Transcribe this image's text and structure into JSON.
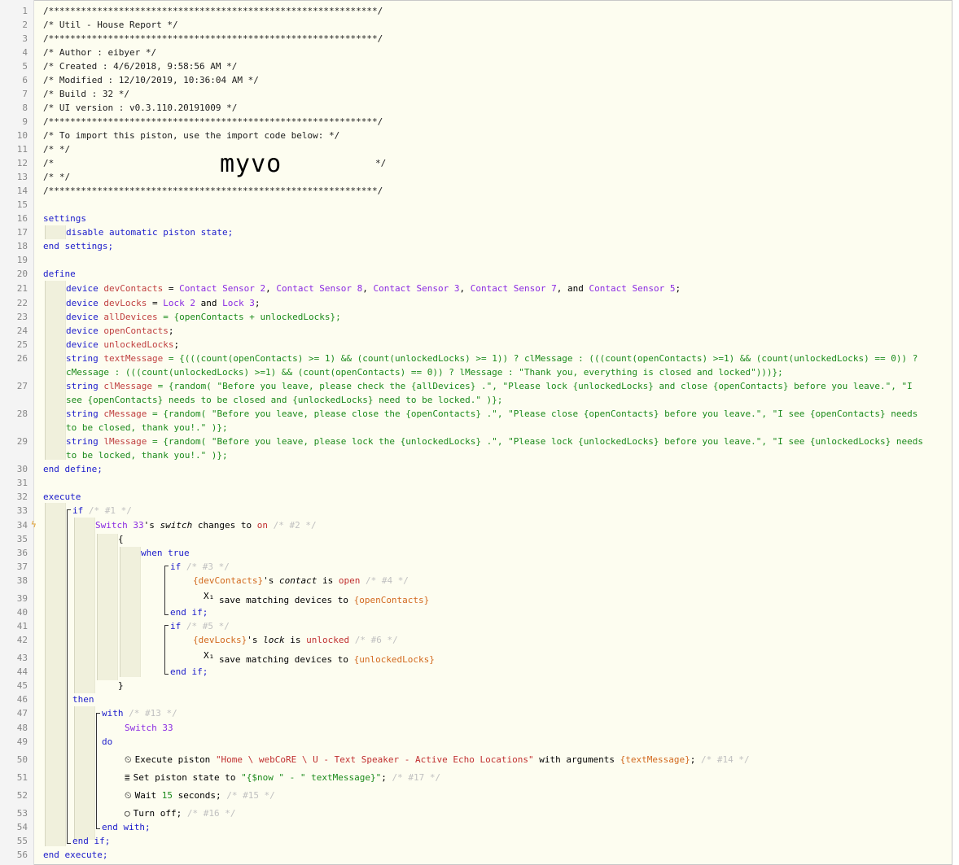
{
  "header": {
    "line1": "/*************************************************************/",
    "line2": "/* Util - House Report                                      */",
    "line3": "/*************************************************************/",
    "line4": "/* Author     : eibyer                                        */",
    "line5": "/* Created    : 4/6/2018, 9:58:56 AM                          */",
    "line6": "/* Modified   : 12/10/2019, 10:36:04 AM                       */",
    "line7": "/* Build      : 32                                            */",
    "line8": "/* UI version : v0.3.110.20191009                            */",
    "line9": "/*************************************************************/",
    "line10": "/* To import this piston, use the import code below:         */",
    "line11": "/*                                                           */",
    "line12a": "/*",
    "line12b": "*/",
    "line13": "/*                                                           */",
    "line14": "/*************************************************************/",
    "import_code": "myvo"
  },
  "settings": {
    "kw": "settings",
    "body": "disable automatic piston state;",
    "end": "end settings;"
  },
  "define": {
    "kw": "define",
    "end": "end define;",
    "device_kw": "device",
    "string_kw": "string",
    "devContacts": "devContacts",
    "contacts": [
      "Contact Sensor 2",
      "Contact Sensor 8",
      "Contact Sensor 3",
      "Contact Sensor 7",
      "Contact Sensor 5"
    ],
    "devLocks": "devLocks",
    "locks": [
      "Lock 2",
      "Lock 3"
    ],
    "allDevices": "allDevices",
    "allDevices_expr": "= {openContacts + unlockedLocks};",
    "openContacts": "openContacts",
    "unlockedLocks": "unlockedLocks",
    "textMessage": "textMessage",
    "textMessage_expr1": "= {(((count(openContacts) >= 1) && (count(unlockedLocks) >= 1)) ? clMessage : (((count(openContacts) >=1) && (count(unlockedLocks) == 0)) ?",
    "textMessage_expr2": "cMessage : (((count(unlockedLocks) >=1) && (count(openContacts) == 0)) ? lMessage : \"Thank you, everything is closed and locked\")))};",
    "clMessage": "clMessage",
    "clMessage_expr1": "= {random( \"Before you leave, please check the {allDevices} .\", \"Please lock {unlockedLocks} and close {openContacts} before you leave.\", \"I",
    "clMessage_expr2": "see {openContacts} needs to be closed and {unlockedLocks} need to be locked.\" )};",
    "cMessage": "cMessage",
    "cMessage_expr1": "= {random( \"Before you leave, please close the {openContacts} .\", \"Please close {openContacts} before you leave.\", \"I see {openContacts} needs",
    "cMessage_expr2": "to be closed, thank you!.\" )};",
    "lMessage": "lMessage",
    "lMessage_expr1": "= {random( \"Before you leave, please lock the {unlockedLocks} .\", \"Please lock {unlockedLocks} before you leave.\", \"I see {unlockedLocks} needs",
    "lMessage_expr2": "to be locked, thank you!.\" )};"
  },
  "execute": {
    "kw": "execute",
    "end": "end execute;",
    "if_kw": "if",
    "c1": "/* #1 */",
    "switch33": "Switch 33",
    "trigger_a": "'s ",
    "trigger_attr": "switch",
    "trigger_b": " changes to ",
    "trigger_val": "on",
    "c2": "/* #2 */",
    "lbrace": "{",
    "rbrace": "}",
    "when_true": "when true",
    "c3": "/* #3 */",
    "devContactsRef": "{devContacts}",
    "contact_attr": "contact",
    "is_kw": " is ",
    "open_val": "open",
    "c4": "/* #4 */",
    "x1": "X₁",
    "save_text": "save matching devices to ",
    "openContactsRef": "{openContacts}",
    "endif": "end if;",
    "c5": "/* #5 */",
    "devLocksRef": "{devLocks}",
    "lock_attr": "lock",
    "unlocked_val": "unlocked",
    "c6": "/* #6 */",
    "unlockedLocksRef": "{unlockedLocks}",
    "then_kw": "then",
    "with_kw": "with",
    "c13": "/* #13 */",
    "do_kw": "do",
    "exec_text": "Execute piston ",
    "exec_str": "\"Home \\ webCoRE \\ U - Text Speaker - Active Echo Locations\"",
    "exec_args": " with arguments ",
    "textMessageRef": "{textMessage}",
    "c14": "/* #14 */",
    "set_text": "Set piston state to ",
    "set_expr": "\"{$now \" - \" textMessage}\"",
    "c17": "/* #17 */",
    "wait_text": "Wait ",
    "wait_num": "15",
    "wait_unit": " seconds;",
    "c15": "/* #15 */",
    "turnoff_text": "Turn off;",
    "c16": "/* #16 */",
    "end_with": "end with;"
  },
  "icons": [
    "timer-icon",
    "list-icon",
    "power-icon",
    "lightning-icon"
  ],
  "colors": {
    "background": "#fdfdf0",
    "keyword": "#1b1bcb",
    "device": "#8a2be2",
    "string": "#1b8a1b",
    "variable": "#d2691e"
  }
}
